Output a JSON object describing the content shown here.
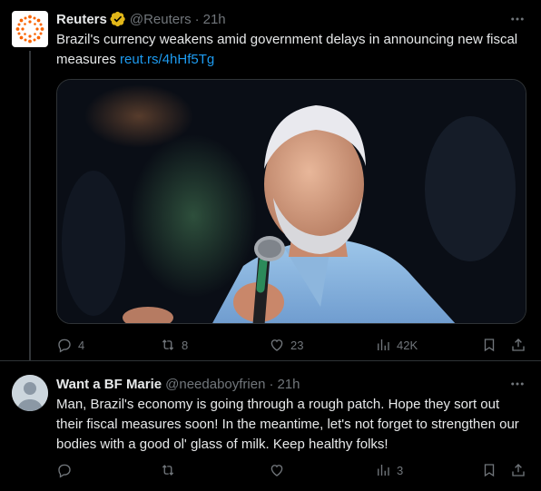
{
  "posts": [
    {
      "author": "Reuters",
      "handle": "@Reuters",
      "time": "21h",
      "verified": true,
      "text": "Brazil's currency weakens amid government delays in announcing new fiscal measures",
      "link": "reut.rs/4hHf5Tg",
      "has_image": true,
      "stats": {
        "replies": "4",
        "reposts": "8",
        "likes": "23",
        "views": "42K"
      }
    },
    {
      "author": "Want a BF Marie",
      "handle": "@needaboyfrien",
      "time": "21h",
      "verified": false,
      "text": "Man, Brazil's economy is going through a rough patch. Hope they sort out their fiscal measures soon! In the meantime, let's not forget to strengthen our bodies with a good ol' glass of milk. Keep healthy folks!",
      "stats": {
        "replies": "",
        "reposts": "",
        "likes": "",
        "views": "3"
      }
    }
  ],
  "colors": {
    "background": "#000000",
    "text": "#e7e9ea",
    "muted": "#71767b",
    "link": "#1d9bf0",
    "verified_badge": "#e2b719",
    "reuters_orange": "#fa6400"
  },
  "icons": [
    "reply-icon",
    "repost-icon",
    "like-icon",
    "views-icon",
    "bookmark-icon",
    "share-icon",
    "more-icon",
    "verified-badge-icon"
  ]
}
